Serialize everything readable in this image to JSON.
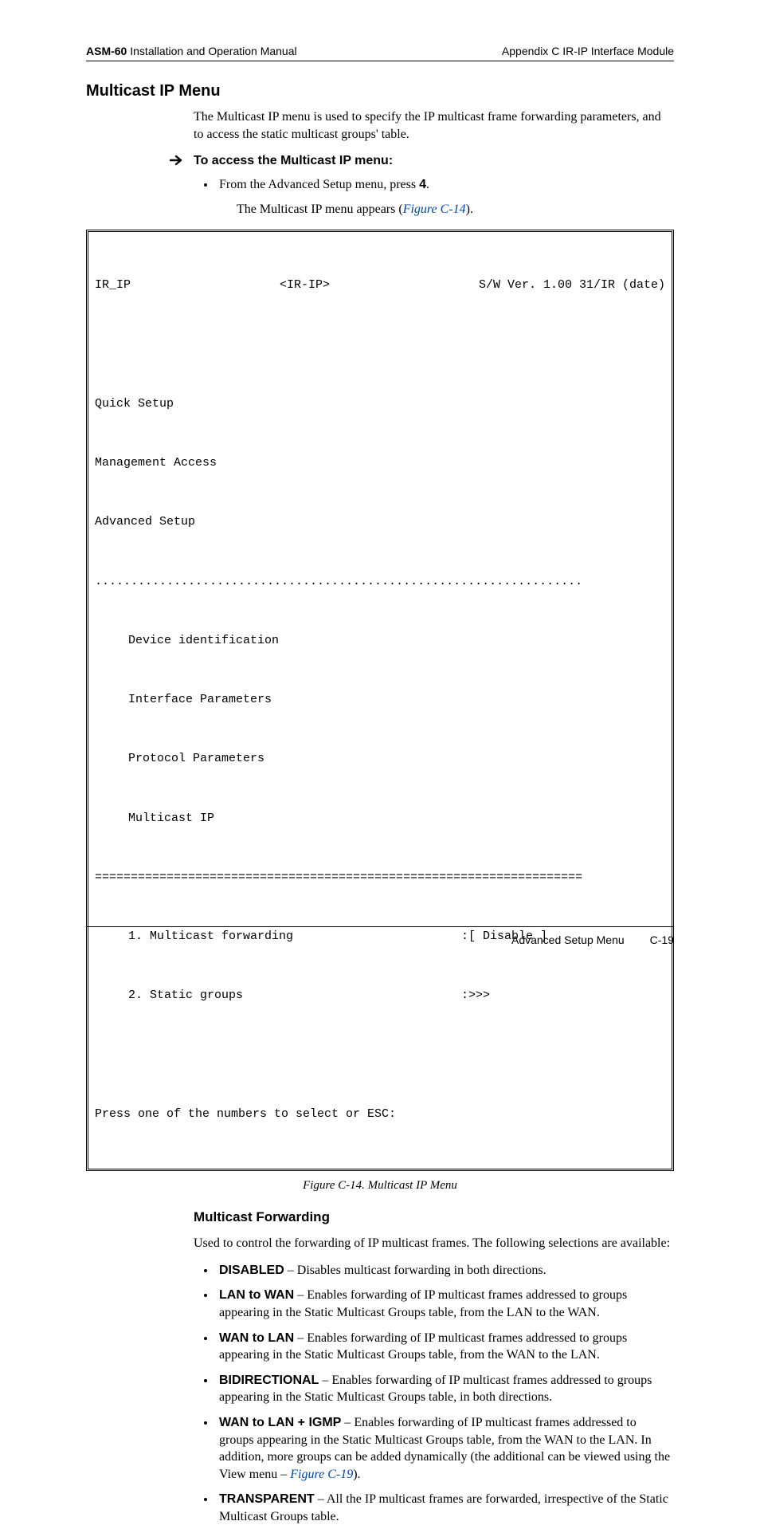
{
  "header": {
    "product": "ASM-60",
    "doc_title_rest": " Installation and Operation Manual",
    "right": "Appendix C  IR-IP Interface Module"
  },
  "section": {
    "title": "Multicast IP Menu",
    "intro": "The Multicast IP menu is used to specify the IP multicast frame forwarding parameters, and to access the static multicast groups' table.",
    "access_heading": "To access the Multicast IP menu:",
    "access_step_pre": "From the Advanced Setup menu, press ",
    "access_step_key": "4",
    "access_step_post": ".",
    "result_pre": "The Multicast IP menu appears (",
    "result_link": "Figure C-14",
    "result_post": ")."
  },
  "code": {
    "top_left": "IR_IP",
    "top_mid": "<IR-IP>",
    "top_right": "S/W Ver. 1.00 31/IR (date)",
    "lines": [
      "Quick Setup",
      "Management Access",
      "Advanced Setup"
    ],
    "dots": "....................................................................",
    "sub": [
      "Device identification",
      "Interface Parameters",
      "Protocol Parameters",
      "Multicast IP"
    ],
    "eqline": "====================================================================",
    "options": [
      {
        "label": "1. Multicast forwarding",
        "value": ":[ Disable ]"
      },
      {
        "label": "2. Static groups",
        "value": ":>>>"
      }
    ],
    "prompt": "Press one of the numbers to select or ESC:"
  },
  "figure": {
    "caption": "Figure C-14.  Multicast IP Menu"
  },
  "forwarding": {
    "title": "Multicast Forwarding",
    "intro": "Used to control the forwarding of IP multicast frames. The following selections are available:",
    "items": [
      {
        "term": "DISABLED",
        "desc": " – Disables multicast forwarding in both directions."
      },
      {
        "term": "LAN to WAN",
        "desc": " – Enables forwarding of IP multicast frames addressed to groups appearing in the Static Multicast Groups table, from the LAN to the WAN."
      },
      {
        "term": "WAN to LAN",
        "desc": " – Enables forwarding of IP multicast frames addressed to groups appearing in the Static Multicast Groups table, from the WAN to the LAN."
      },
      {
        "term": "BIDIRECTIONAL",
        "desc": " – Enables forwarding of IP multicast frames addressed to groups appearing in the Static Multicast Groups table, in both directions."
      },
      {
        "term": "WAN to LAN + IGMP",
        "desc_pre": " – Enables forwarding of IP multicast frames addressed to groups appearing in the Static Multicast Groups table, from the WAN to the LAN. In addition, more groups can be added dynamically (the additional can be viewed using the View menu – ",
        "link": "Figure C-19",
        "desc_post": ")."
      },
      {
        "term": "TRANSPARENT",
        "desc": " – All the IP multicast frames are forwarded, irrespective of the Static Multicast Groups table."
      }
    ]
  },
  "footer": {
    "section": "Advanced Setup Menu",
    "page": "C-19"
  }
}
